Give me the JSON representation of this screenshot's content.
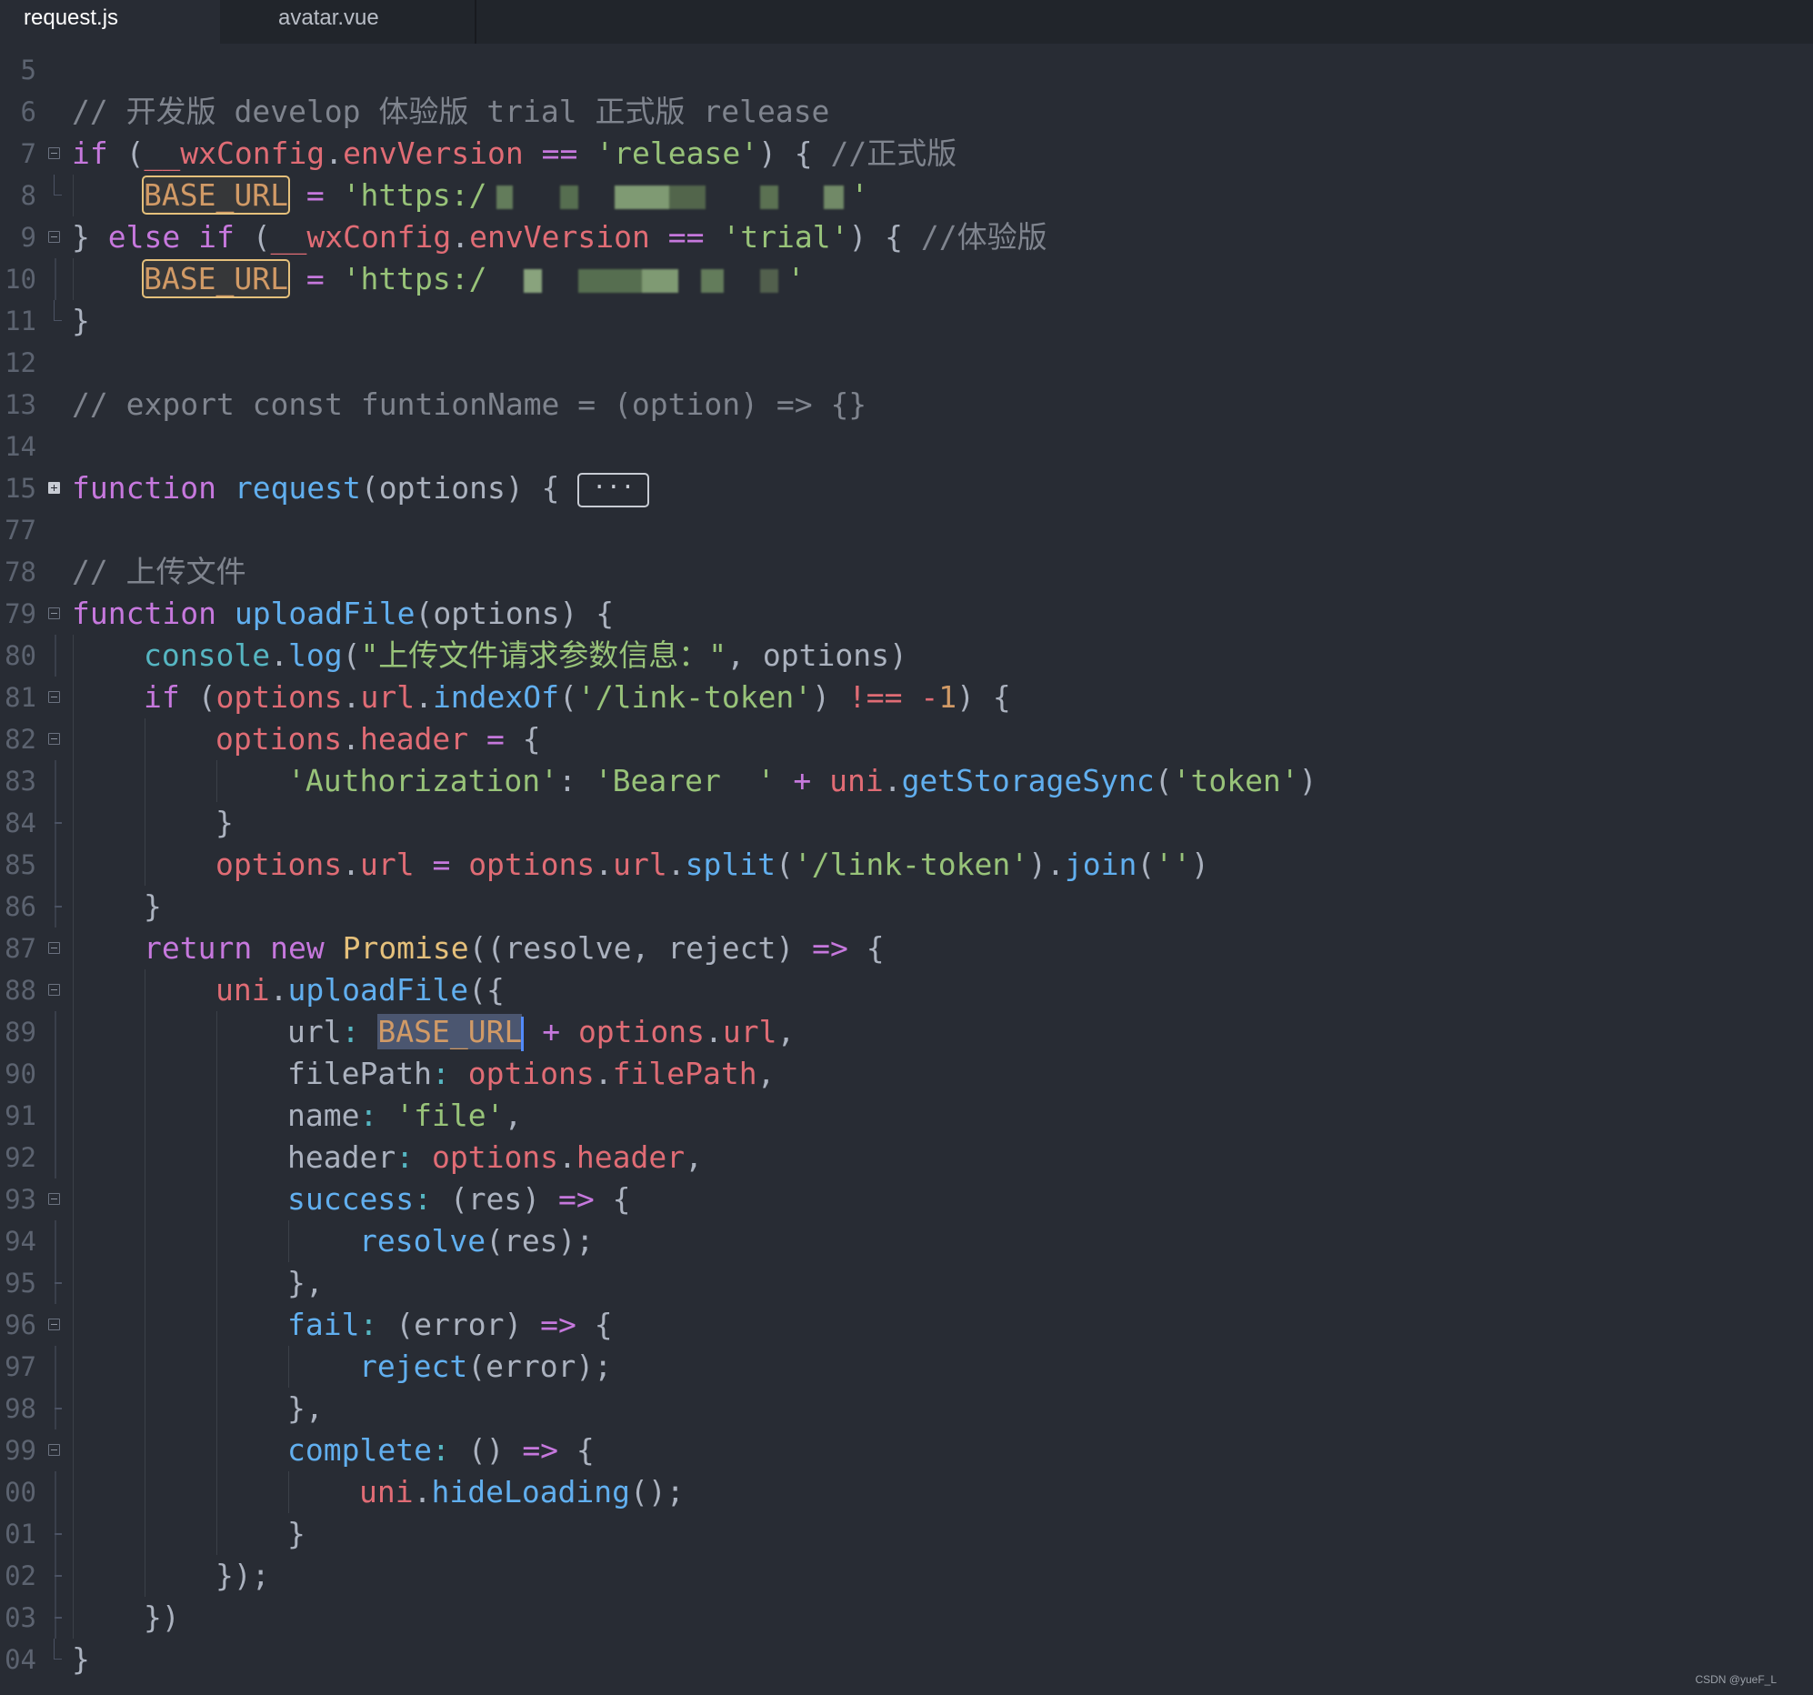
{
  "tabs": [
    {
      "label": "request.js",
      "active": true
    },
    {
      "label": "avatar.vue",
      "active": false
    }
  ],
  "code": {
    "lines": [
      {
        "n": "5",
        "fold": "none",
        "indent": 0,
        "tokens": []
      },
      {
        "n": "6",
        "fold": "none",
        "indent": 0,
        "tokens": [
          [
            "cmt",
            "// 开发版 develop 体验版 trial 正式版 release"
          ]
        ]
      },
      {
        "n": "7",
        "fold": "open",
        "indent": 0,
        "tokens": [
          [
            "kw",
            "if"
          ],
          [
            "p",
            " ("
          ],
          [
            "var",
            "__wxConfig"
          ],
          [
            "p",
            "."
          ],
          [
            "var",
            "envVersion"
          ],
          [
            "p",
            " "
          ],
          [
            "op",
            "=="
          ],
          [
            "p",
            " "
          ],
          [
            "str",
            "'release'"
          ],
          [
            "p",
            ") { "
          ],
          [
            "cmt",
            "//正式版"
          ]
        ]
      },
      {
        "n": "8",
        "fold": "end",
        "indent": 1,
        "tokens": [
          [
            "box",
            "BASE_URL"
          ],
          [
            "p",
            " "
          ],
          [
            "op",
            "="
          ],
          [
            "p",
            " "
          ],
          [
            "str",
            "'https:/"
          ],
          [
            "blur",
            ""
          ],
          [
            "str",
            "'"
          ]
        ]
      },
      {
        "n": "9",
        "fold": "open",
        "indent": 0,
        "tokens": [
          [
            "p",
            "} "
          ],
          [
            "kw",
            "else"
          ],
          [
            "p",
            " "
          ],
          [
            "kw",
            "if"
          ],
          [
            "p",
            " ("
          ],
          [
            "var",
            "__wxConfig"
          ],
          [
            "p",
            "."
          ],
          [
            "var",
            "envVersion"
          ],
          [
            "p",
            " "
          ],
          [
            "op",
            "=="
          ],
          [
            "p",
            " "
          ],
          [
            "str",
            "'trial'"
          ],
          [
            "p",
            ") { "
          ],
          [
            "cmt",
            "//体验版"
          ]
        ]
      },
      {
        "n": "10",
        "fold": "bar",
        "indent": 1,
        "tokens": [
          [
            "box",
            "BASE_URL"
          ],
          [
            "p",
            " "
          ],
          [
            "op",
            "="
          ],
          [
            "p",
            " "
          ],
          [
            "str",
            "'https:/"
          ],
          [
            "blur2",
            ""
          ],
          [
            "str",
            "'"
          ]
        ]
      },
      {
        "n": "11",
        "fold": "end",
        "indent": 0,
        "tokens": [
          [
            "p",
            "}"
          ]
        ]
      },
      {
        "n": "12",
        "fold": "none",
        "indent": 0,
        "tokens": []
      },
      {
        "n": "13",
        "fold": "none",
        "indent": 0,
        "tokens": [
          [
            "cmt",
            "// export const funtionName = (option) => {}"
          ]
        ]
      },
      {
        "n": "14",
        "fold": "none",
        "indent": 0,
        "tokens": []
      },
      {
        "n": "15",
        "fold": "closed",
        "indent": 0,
        "tokens": [
          [
            "kw",
            "function"
          ],
          [
            "p",
            " "
          ],
          [
            "fn",
            "request"
          ],
          [
            "p",
            "(options) { "
          ],
          [
            "foldbox",
            "···"
          ]
        ]
      },
      {
        "n": "77",
        "fold": "none",
        "indent": 0,
        "tokens": []
      },
      {
        "n": "78",
        "fold": "none",
        "indent": 0,
        "tokens": [
          [
            "cmt",
            "// 上传文件"
          ]
        ]
      },
      {
        "n": "79",
        "fold": "open",
        "indent": 0,
        "tokens": [
          [
            "kw",
            "function"
          ],
          [
            "p",
            " "
          ],
          [
            "fn",
            "uploadFile"
          ],
          [
            "p",
            "(options) {"
          ]
        ]
      },
      {
        "n": "80",
        "fold": "bar",
        "indent": 1,
        "tokens": [
          [
            "cyan",
            "console"
          ],
          [
            "p",
            "."
          ],
          [
            "fn",
            "log"
          ],
          [
            "p",
            "("
          ],
          [
            "str",
            "\"上传文件请求参数信息：\""
          ],
          [
            "p",
            ", options)"
          ]
        ]
      },
      {
        "n": "81",
        "fold": "open",
        "indent": 1,
        "tokens": [
          [
            "kw",
            "if"
          ],
          [
            "p",
            " ("
          ],
          [
            "var",
            "options"
          ],
          [
            "p",
            "."
          ],
          [
            "var",
            "url"
          ],
          [
            "p",
            "."
          ],
          [
            "fn",
            "indexOf"
          ],
          [
            "p",
            "("
          ],
          [
            "str",
            "'/link-token'"
          ],
          [
            "p",
            ") "
          ],
          [
            "var",
            "!=="
          ],
          [
            "p",
            " "
          ],
          [
            "var",
            "-"
          ],
          [
            "num",
            "1"
          ],
          [
            "p",
            ") {"
          ]
        ]
      },
      {
        "n": "82",
        "fold": "open",
        "indent": 2,
        "tokens": [
          [
            "var",
            "options"
          ],
          [
            "p",
            "."
          ],
          [
            "var",
            "header"
          ],
          [
            "p",
            " "
          ],
          [
            "op",
            "="
          ],
          [
            "p",
            " {"
          ]
        ]
      },
      {
        "n": "83",
        "fold": "bar",
        "indent": 3,
        "tokens": [
          [
            "str",
            "'Authorization'"
          ],
          [
            "p",
            ": "
          ],
          [
            "str",
            "'Bearer  '"
          ],
          [
            "p",
            " "
          ],
          [
            "op",
            "+"
          ],
          [
            "p",
            " "
          ],
          [
            "var",
            "uni"
          ],
          [
            "p",
            "."
          ],
          [
            "fn",
            "getStorageSync"
          ],
          [
            "p",
            "("
          ],
          [
            "str",
            "'token'"
          ],
          [
            "p",
            ")"
          ]
        ]
      },
      {
        "n": "84",
        "fold": "tick",
        "indent": 2,
        "tokens": [
          [
            "p",
            "}"
          ]
        ]
      },
      {
        "n": "85",
        "fold": "bar",
        "indent": 2,
        "tokens": [
          [
            "var",
            "options"
          ],
          [
            "p",
            "."
          ],
          [
            "var",
            "url"
          ],
          [
            "p",
            " "
          ],
          [
            "op",
            "="
          ],
          [
            "p",
            " "
          ],
          [
            "var",
            "options"
          ],
          [
            "p",
            "."
          ],
          [
            "var",
            "url"
          ],
          [
            "p",
            "."
          ],
          [
            "fn",
            "split"
          ],
          [
            "p",
            "("
          ],
          [
            "str",
            "'/link-token'"
          ],
          [
            "p",
            ")."
          ],
          [
            "fn",
            "join"
          ],
          [
            "p",
            "("
          ],
          [
            "str",
            "''"
          ],
          [
            "p",
            ")"
          ]
        ]
      },
      {
        "n": "86",
        "fold": "tick",
        "indent": 1,
        "tokens": [
          [
            "p",
            "}"
          ]
        ]
      },
      {
        "n": "87",
        "fold": "open",
        "indent": 1,
        "tokens": [
          [
            "kw",
            "return"
          ],
          [
            "p",
            " "
          ],
          [
            "kw",
            "new"
          ],
          [
            "p",
            " "
          ],
          [
            "cls",
            "Promise"
          ],
          [
            "p",
            "((resolve, reject) "
          ],
          [
            "op",
            "=>"
          ],
          [
            "p",
            " {"
          ]
        ]
      },
      {
        "n": "88",
        "fold": "open",
        "indent": 2,
        "tokens": [
          [
            "var",
            "uni"
          ],
          [
            "p",
            "."
          ],
          [
            "fn",
            "uploadFile"
          ],
          [
            "p",
            "({"
          ]
        ]
      },
      {
        "n": "89",
        "fold": "bar",
        "indent": 3,
        "tokens": [
          [
            "p",
            "url"
          ],
          [
            "cyan",
            ":"
          ],
          [
            "p",
            " "
          ],
          [
            "sel",
            "BASE_URL"
          ],
          [
            "cursor",
            ""
          ],
          [
            "p",
            " "
          ],
          [
            "op",
            "+"
          ],
          [
            "p",
            " "
          ],
          [
            "var",
            "options"
          ],
          [
            "p",
            "."
          ],
          [
            "var",
            "url"
          ],
          [
            "p",
            ","
          ]
        ]
      },
      {
        "n": "90",
        "fold": "bar",
        "indent": 3,
        "tokens": [
          [
            "p",
            "filePath"
          ],
          [
            "cyan",
            ":"
          ],
          [
            "p",
            " "
          ],
          [
            "var",
            "options"
          ],
          [
            "p",
            "."
          ],
          [
            "var",
            "filePath"
          ],
          [
            "p",
            ","
          ]
        ]
      },
      {
        "n": "91",
        "fold": "bar",
        "indent": 3,
        "tokens": [
          [
            "p",
            "name"
          ],
          [
            "cyan",
            ":"
          ],
          [
            "p",
            " "
          ],
          [
            "str",
            "'file'"
          ],
          [
            "p",
            ","
          ]
        ]
      },
      {
        "n": "92",
        "fold": "bar",
        "indent": 3,
        "tokens": [
          [
            "p",
            "header"
          ],
          [
            "cyan",
            ":"
          ],
          [
            "p",
            " "
          ],
          [
            "var",
            "options"
          ],
          [
            "p",
            "."
          ],
          [
            "var",
            "header"
          ],
          [
            "p",
            ","
          ]
        ]
      },
      {
        "n": "93",
        "fold": "open",
        "indent": 3,
        "tokens": [
          [
            "fn",
            "success"
          ],
          [
            "cyan",
            ":"
          ],
          [
            "p",
            " (res) "
          ],
          [
            "op",
            "=>"
          ],
          [
            "p",
            " {"
          ]
        ]
      },
      {
        "n": "94",
        "fold": "bar",
        "indent": 4,
        "tokens": [
          [
            "fn",
            "resolve"
          ],
          [
            "p",
            "(res);"
          ]
        ]
      },
      {
        "n": "95",
        "fold": "tick",
        "indent": 3,
        "tokens": [
          [
            "p",
            "},"
          ]
        ]
      },
      {
        "n": "96",
        "fold": "open",
        "indent": 3,
        "tokens": [
          [
            "fn",
            "fail"
          ],
          [
            "cyan",
            ":"
          ],
          [
            "p",
            " (error) "
          ],
          [
            "op",
            "=>"
          ],
          [
            "p",
            " {"
          ]
        ]
      },
      {
        "n": "97",
        "fold": "bar",
        "indent": 4,
        "tokens": [
          [
            "fn",
            "reject"
          ],
          [
            "p",
            "(error);"
          ]
        ]
      },
      {
        "n": "98",
        "fold": "tick",
        "indent": 3,
        "tokens": [
          [
            "p",
            "},"
          ]
        ]
      },
      {
        "n": "99",
        "fold": "open",
        "indent": 3,
        "tokens": [
          [
            "fn",
            "complete"
          ],
          [
            "cyan",
            ":"
          ],
          [
            "p",
            " () "
          ],
          [
            "op",
            "=>"
          ],
          [
            "p",
            " {"
          ]
        ]
      },
      {
        "n": "00",
        "fold": "bar",
        "indent": 4,
        "tokens": [
          [
            "var",
            "uni"
          ],
          [
            "p",
            "."
          ],
          [
            "fn",
            "hideLoading"
          ],
          [
            "p",
            "();"
          ]
        ]
      },
      {
        "n": "01",
        "fold": "tick",
        "indent": 3,
        "tokens": [
          [
            "p",
            "}"
          ]
        ]
      },
      {
        "n": "02",
        "fold": "tick",
        "indent": 2,
        "tokens": [
          [
            "p",
            "});"
          ]
        ]
      },
      {
        "n": "03",
        "fold": "tick",
        "indent": 1,
        "tokens": [
          [
            "p",
            "})"
          ]
        ]
      },
      {
        "n": "04",
        "fold": "end",
        "indent": 0,
        "tokens": [
          [
            "p",
            "}"
          ]
        ]
      }
    ]
  },
  "watermark": "CSDN @yueF_L",
  "colors": {
    "background": "#282c34",
    "tabbar": "#21252b",
    "highlight_box": "#e5c07b",
    "selection": "#4b5670",
    "cursor": "#528bff"
  }
}
